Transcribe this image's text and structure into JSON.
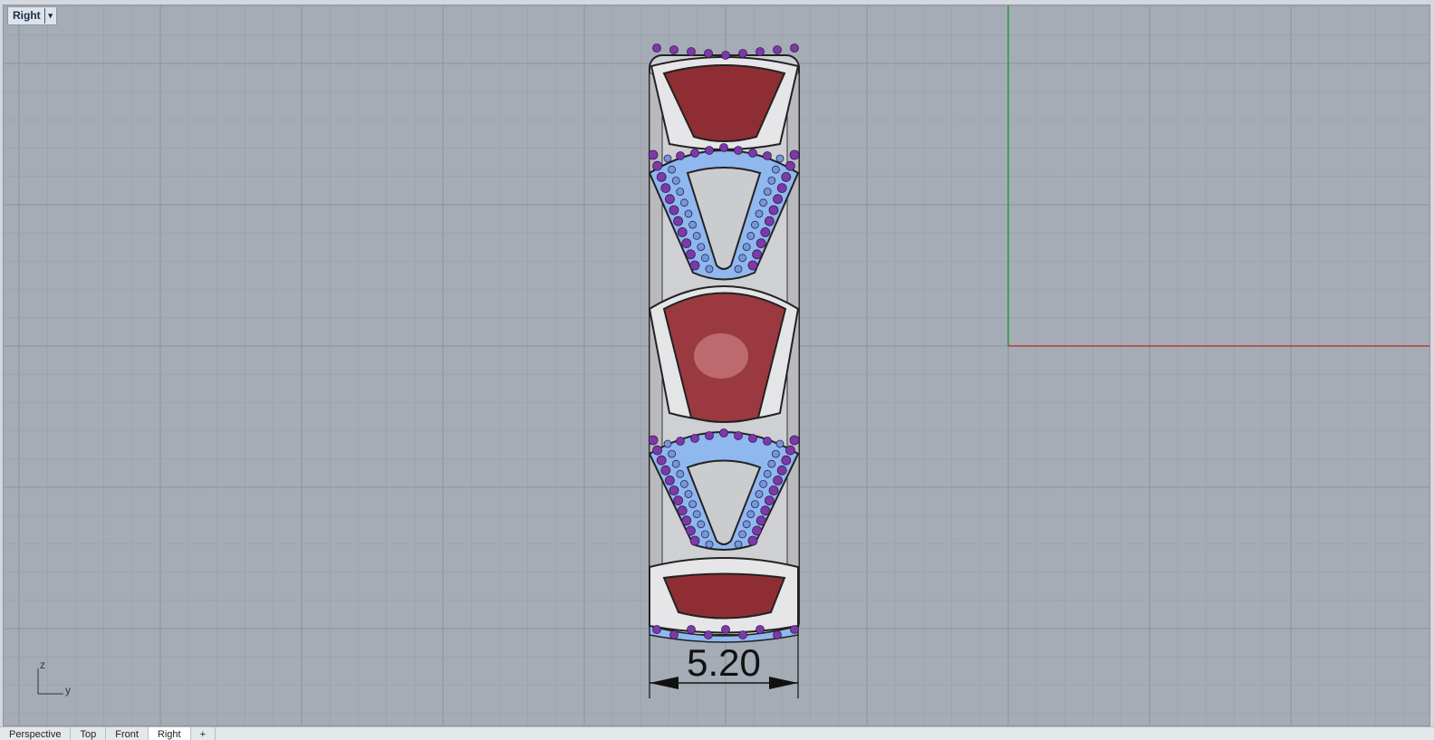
{
  "viewport": {
    "name": "Right",
    "menu_icon": "dropdown-arrow-icon"
  },
  "dimension": {
    "label": "5.20"
  },
  "axis_labels": {
    "vertical": "z",
    "horizontal": "y"
  },
  "colors": {
    "background": "#a5acb5",
    "grid_minor": "#9aa1aa",
    "grid_major": "#8b929b",
    "x_axis": "#b83c3c",
    "y_axis": "#2e9a3e",
    "metal": "#d9d9db",
    "ruby": "#8e2e34",
    "pave": "#8fb8ee",
    "amethyst": "#7b3aa8"
  },
  "bottom_tabs": [
    "Perspective",
    "Top",
    "Front",
    "Right",
    "+"
  ]
}
